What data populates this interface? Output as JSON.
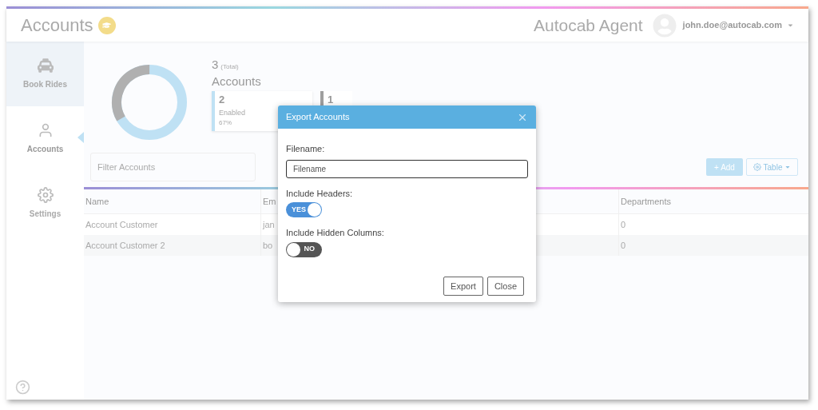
{
  "header": {
    "title": "Accounts",
    "app_name": "Autocab Agent",
    "user": "john.doe@autocab.com"
  },
  "sidebar": {
    "items": [
      {
        "label": "Book Rides",
        "selected": false,
        "hovered": true
      },
      {
        "label": "Accounts",
        "selected": true,
        "hovered": false
      },
      {
        "label": "Settings",
        "selected": false,
        "hovered": false
      }
    ]
  },
  "summary": {
    "total": "3",
    "total_label": "(Total)",
    "title": "Accounts",
    "cards": [
      {
        "value": "2",
        "label": "Enabled",
        "percent": "67%",
        "color": "#bfe1f4"
      },
      {
        "value": "1",
        "color": "#9e9e9e"
      }
    ]
  },
  "filter": {
    "placeholder": "Filter Accounts"
  },
  "toolbar": {
    "add": "+ Add",
    "table": "Table"
  },
  "table": {
    "columns": [
      "Name",
      "Em",
      "Departments"
    ],
    "rows": [
      [
        "Account Customer",
        "jan",
        "0"
      ],
      [
        "Account Customer 2",
        "bo",
        "0"
      ]
    ]
  },
  "dialog": {
    "title": "Export Accounts",
    "filename_label": "Filename:",
    "filename_placeholder": "Filename",
    "options": [
      {
        "label": "Include Headers:",
        "on": true,
        "text": "YES"
      },
      {
        "label": "Include Hidden Columns:",
        "on": false,
        "text": "NO"
      }
    ],
    "buttons": [
      "Export",
      "Close"
    ]
  }
}
